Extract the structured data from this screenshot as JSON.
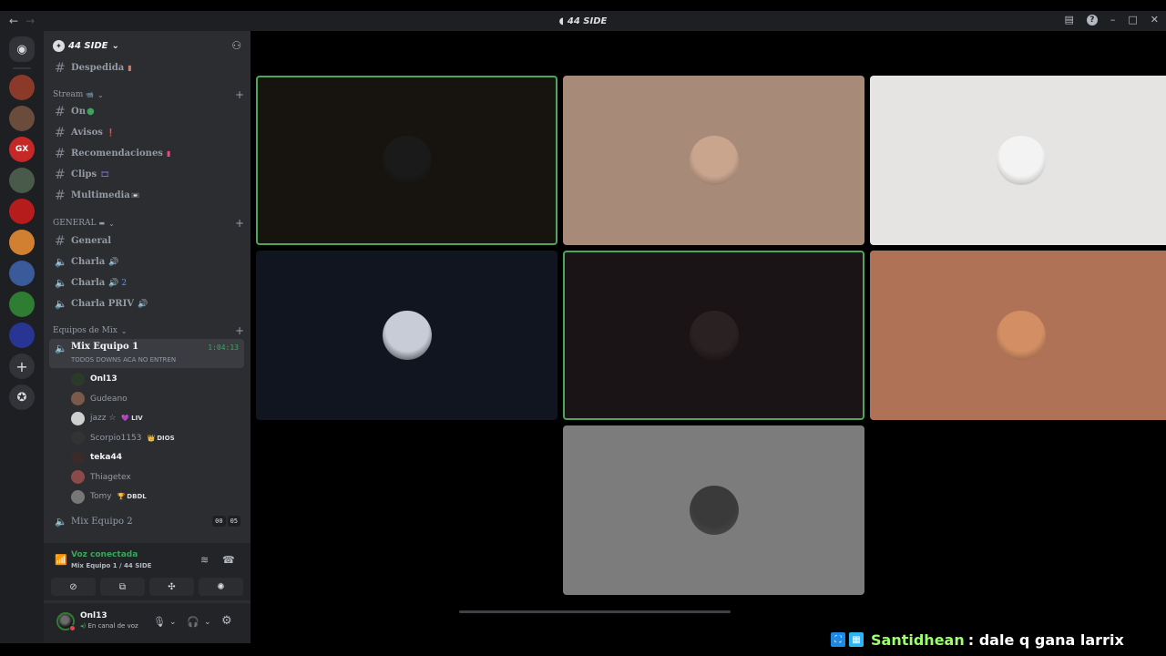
{
  "window": {
    "title": "44 SIDE",
    "nav_back": "←",
    "nav_forward": "→",
    "controls": {
      "inbox": "▤",
      "help": "?",
      "minimize": "–",
      "maximize": "□",
      "close": "✕"
    }
  },
  "rail": {
    "home_icon": "discord-icon",
    "home_glyph": "◉",
    "servers": [
      {
        "label": "",
        "color": "#8b3a2a"
      },
      {
        "label": "",
        "color": "#6a4c3c"
      },
      {
        "label": "GX",
        "color": "#c62828"
      },
      {
        "label": "",
        "color": "#4a5a4a"
      },
      {
        "label": "",
        "color": "#b71c1c"
      },
      {
        "label": "",
        "color": "#d08030"
      },
      {
        "label": "",
        "color": "#3a5a9a"
      },
      {
        "label": "",
        "color": "#2e7d32"
      },
      {
        "label": "",
        "color": "#283593"
      }
    ],
    "add_glyph": "+",
    "explore_glyph": "✪"
  },
  "guild": {
    "name": "44 SIDE",
    "chevron": "⌄",
    "add_friend_glyph": "⚇"
  },
  "channels_top": [
    {
      "name": "Despedida",
      "emoji": "▮"
    }
  ],
  "categories": {
    "stream": {
      "label": "Stream",
      "emoji": "📹"
    },
    "general": {
      "label": "GENERAL",
      "emoji": "▬"
    },
    "mix": {
      "label": "Equipos de Mix"
    }
  },
  "stream_channels": [
    {
      "name": "On",
      "emoji": "●"
    },
    {
      "name": "Avisos",
      "emoji": "❗"
    },
    {
      "name": "Recomendaciones",
      "emoji": "▮"
    },
    {
      "name": "Clips",
      "emoji": "🎞"
    },
    {
      "name": "Multimedia",
      "emoji": "📼"
    }
  ],
  "general_channels": [
    {
      "type": "text",
      "name": "General",
      "suffix": ""
    },
    {
      "type": "voice",
      "name": "Charla",
      "suffix": "🔊"
    },
    {
      "type": "voice",
      "name": "Charla",
      "suffix": "🔊 2"
    },
    {
      "type": "voice",
      "name": "Charla PRIV",
      "suffix": "🔊"
    }
  ],
  "active_voice": {
    "name": "Mix Equipo 1",
    "status": "TODOS DOWNS ACA NO ENTREN",
    "timer": "1:04:13"
  },
  "voice_users": [
    {
      "name": "Onl13",
      "bright": true,
      "tag": "",
      "tag_icon": "",
      "avatar": "#2b3a2b"
    },
    {
      "name": "Gudeano",
      "bright": false,
      "tag": "",
      "tag_icon": "",
      "avatar": "#7a5a4a"
    },
    {
      "name": "jazz ☆",
      "bright": false,
      "tag": "LIV",
      "tag_icon": "💜",
      "avatar": "#cfcfcf"
    },
    {
      "name": "Scorpio1153",
      "bright": false,
      "tag": "DIOS",
      "tag_icon": "👑",
      "avatar": "#333333"
    },
    {
      "name": "teka44",
      "bright": true,
      "tag": "",
      "tag_icon": "",
      "avatar": "#3a2a2a"
    },
    {
      "name": "Thiagetex",
      "bright": false,
      "tag": "",
      "tag_icon": "",
      "avatar": "#8a4a4a"
    },
    {
      "name": "Tomy",
      "bright": false,
      "tag": "DBDL",
      "tag_icon": "🏆",
      "avatar": "#777777"
    }
  ],
  "mix2": {
    "name": "Mix Equipo 2",
    "count_a": "00",
    "count_b": "05"
  },
  "voice_panel": {
    "title": "Voz conectada",
    "subtitle": "Mix Equipo 1 / 44 SIDE",
    "noise_glyph": "≋",
    "disconnect_glyph": "☎",
    "buttons": [
      "⊘",
      "⧉",
      "✣",
      "✺"
    ]
  },
  "user_panel": {
    "name": "Onl13",
    "status": "En canal de voz",
    "mic_glyph": "🎙",
    "headset_glyph": "🎧",
    "settings_glyph": "⚙",
    "caret": "⌄"
  },
  "tiles": [
    {
      "bg": "#17140f",
      "speaking": true,
      "avatar": "#1a1a1a"
    },
    {
      "bg": "#a88a78",
      "speaking": false,
      "avatar": "#caa58e"
    },
    {
      "bg": "#e5e4e2",
      "speaking": false,
      "avatar": "#f3f3f3"
    },
    {
      "bg": "#111520",
      "speaking": false,
      "avatar": "#c8ccd6"
    },
    {
      "bg": "#1b1416",
      "speaking": true,
      "avatar": "#2a2222"
    },
    {
      "bg": "#b07257",
      "speaking": false,
      "avatar": "#d38f63"
    },
    {
      "bg": "#7c7c7c",
      "speaking": false,
      "avatar": "#3a3a3a"
    }
  ],
  "chat": {
    "badge1": "⛶",
    "badge2": "▦",
    "username": "Santidhean",
    "message": ": dale q gana larrix",
    "name_color": "#9cff6c"
  }
}
